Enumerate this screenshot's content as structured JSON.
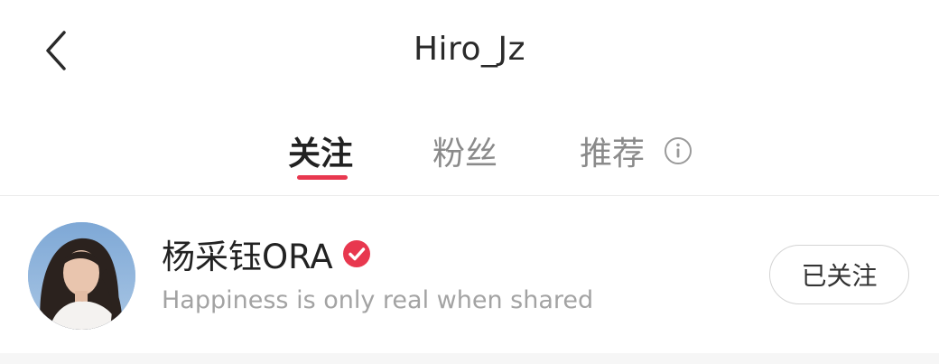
{
  "header": {
    "title": "Hiro_Jz",
    "back_icon": "chevron-left-icon"
  },
  "tabs": [
    {
      "label": "关注",
      "active": true
    },
    {
      "label": "粉丝",
      "active": false
    },
    {
      "label": "推荐",
      "active": false,
      "icon": "info-icon"
    }
  ],
  "following_list": [
    {
      "name": "杨采钰ORA",
      "verified": true,
      "bio": "Happiness is only real when shared",
      "button_label": "已关注",
      "avatar_icon": "avatar"
    }
  ],
  "colors": {
    "accent": "#e8384f",
    "verified_badge": "#e8384f",
    "inactive_tab": "#8a8a8a",
    "bio_text": "#a3a3a3"
  }
}
